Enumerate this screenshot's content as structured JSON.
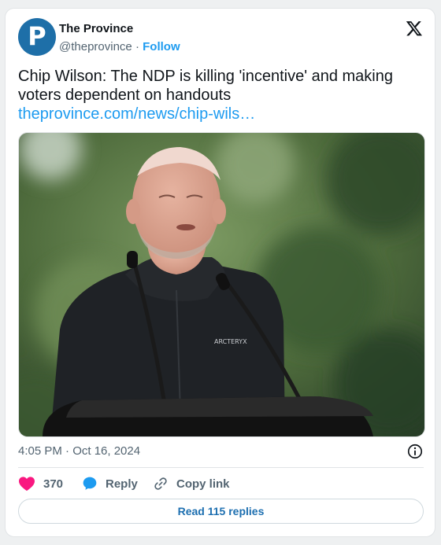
{
  "account": {
    "name": "The Province",
    "avatar_letter": "P",
    "handle": "@theprovince",
    "separator": "·",
    "follow_label": "Follow"
  },
  "tweet": {
    "text": "Chip Wilson: The NDP is killing 'incentive' and making voters dependent on handouts",
    "link": "theprovince.com/news/chip-wils…",
    "time": "4:05 PM · Oct 16, 2024"
  },
  "media": {
    "alt": "Photo of a man speaking at a podium outdoors",
    "jacket_brand": "ARCTERYX"
  },
  "actions": {
    "like_count": "370",
    "reply_label": "Reply",
    "copy_link_label": "Copy link",
    "read_replies_label": "Read 115 replies"
  },
  "colors": {
    "accent": "#1d9bf0",
    "like": "#f91880",
    "brand_avatar": "#1e6fa8"
  },
  "icons": [
    "x-logo-icon",
    "info-icon",
    "heart-icon",
    "reply-bubble-icon",
    "link-icon"
  ]
}
